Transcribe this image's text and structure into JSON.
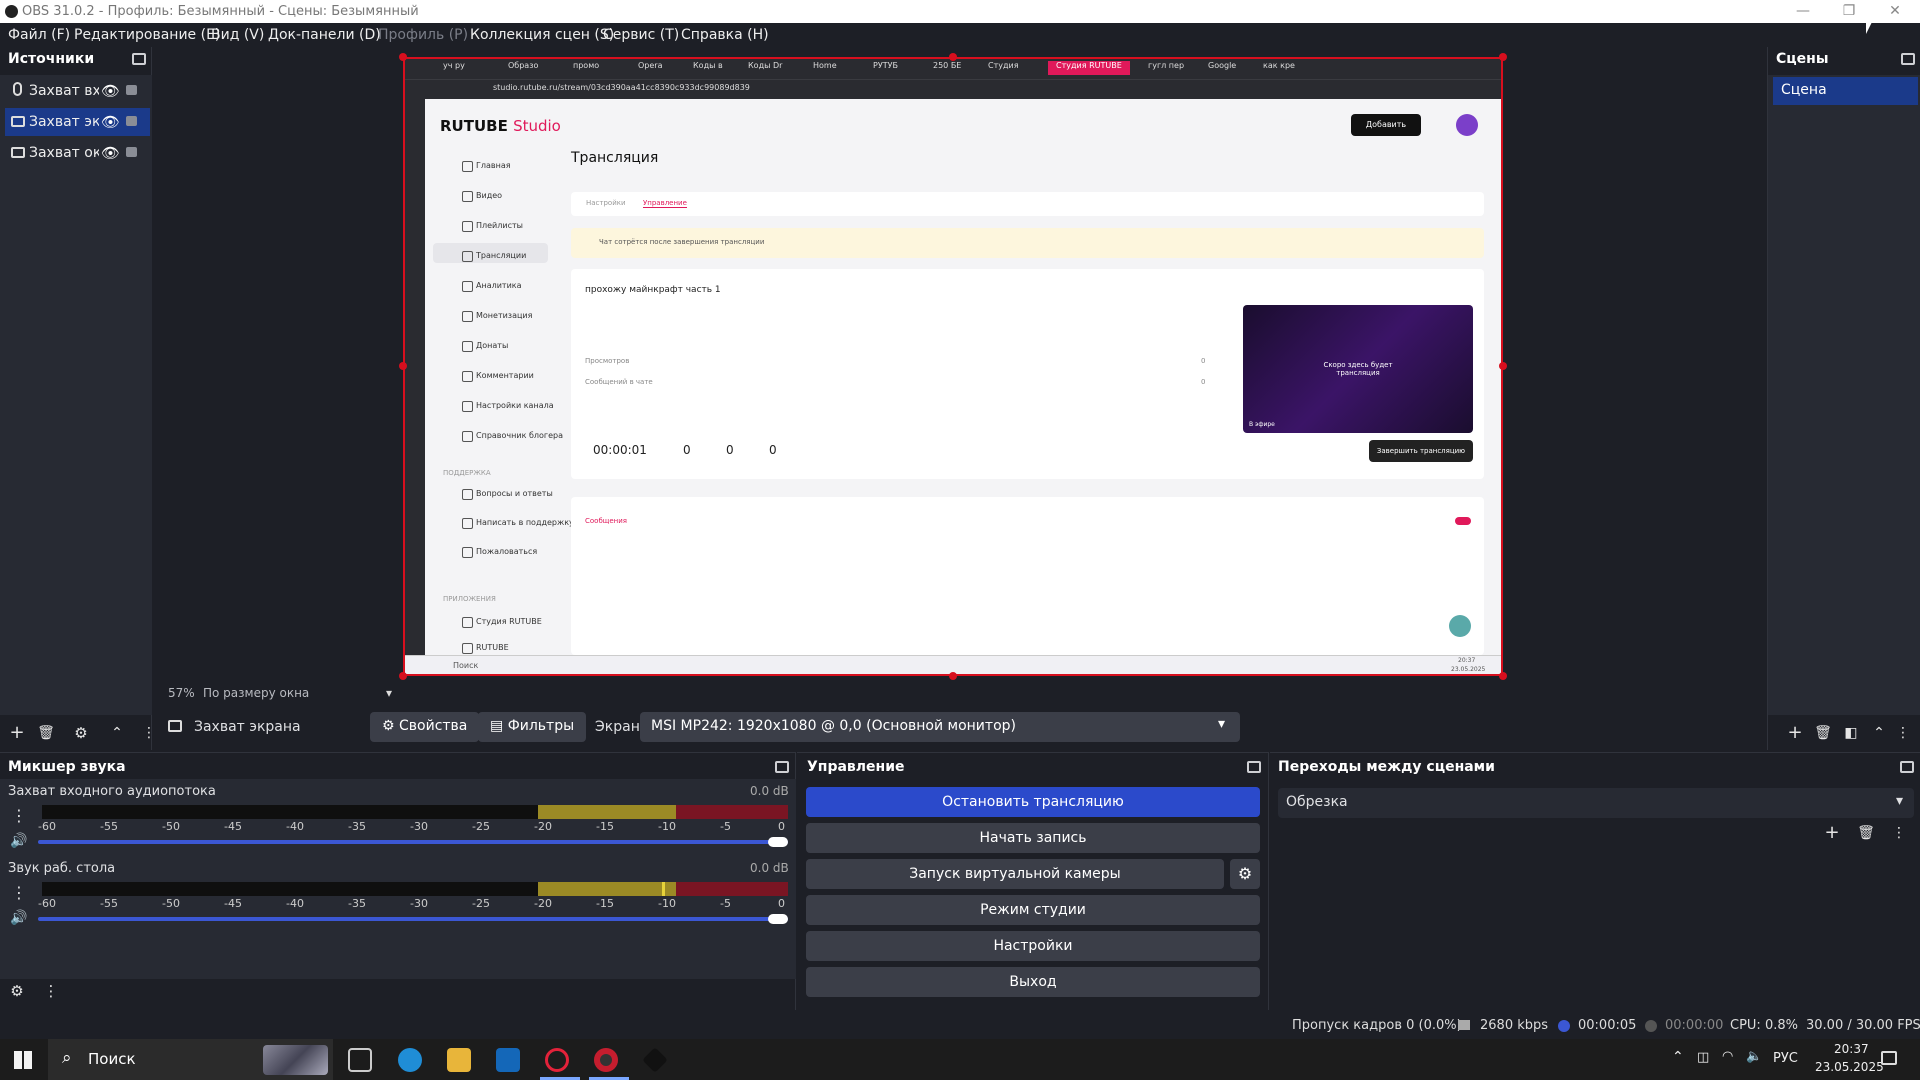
{
  "window": {
    "title": "OBS 31.0.2 - Профиль: Безымянный - Сцены: Безымянный",
    "minimize": "—",
    "maximize": "❐",
    "close": "✕"
  },
  "menu": [
    "Файл (F)",
    "Редактирование (E)",
    "Вид (V)",
    "Док-панели (D)",
    "Профиль (P)",
    "Коллекция сцен (S)",
    "Сервис (T)",
    "Справка (H)"
  ],
  "sources": {
    "title": "Источники",
    "items": [
      {
        "label": "Захват вхо",
        "icon": "microphone-icon"
      },
      {
        "label": "Захват экр",
        "icon": "monitor-icon",
        "selected": true
      },
      {
        "label": "Захват окн",
        "icon": "window-icon"
      }
    ]
  },
  "scenes": {
    "title": "Сцены",
    "items": [
      {
        "label": "Сцена",
        "selected": true
      }
    ]
  },
  "preview": {
    "zoom": "57%",
    "fit": "По размеру окна",
    "browser": {
      "tabs": [
        "уч ру",
        "Образо",
        "промо",
        "Opera",
        "Коды в",
        "Коды Dr",
        "Home",
        "РУТУБ",
        "250 БЕ",
        "Студия",
        "Студия RUTUBE",
        "гугл пер",
        "Google",
        "как кре"
      ],
      "url": "studio.rutube.ru/stream/03cd390aa41cc8390c933dc99089d839"
    },
    "rutube": {
      "logo": "RUTUBE",
      "logo2": "Studio",
      "add_button": "Добавить",
      "page_title": "Трансляция",
      "tab_settings": "Настройки",
      "tab_manage": "Управление",
      "notice": "Чат сотрётся после завершения трансляции",
      "nav": [
        "Главная",
        "Видео",
        "Плейлисты",
        "Трансляции",
        "Аналитика",
        "Монетизация",
        "Донаты",
        "Комментарии",
        "Настройки канала",
        "Справочник блогера"
      ],
      "support_title": "ПОДДЕРЖКА",
      "support": [
        "Вопросы и ответы",
        "Написать в поддержку",
        "Пожаловаться"
      ],
      "apps_title": "ПРИЛОЖЕНИЯ",
      "apps": [
        "Студия RUTUBE",
        "RUTUBE"
      ],
      "stream_title": "прохожу майнкрафт часть 1",
      "views_label": "Просмотров",
      "views_value": "0",
      "messages_label": "Сообщений в чате",
      "messages_value": "0",
      "timer": "00:00:01",
      "stat1": "0",
      "stat2": "0",
      "stat3": "0",
      "preview_text": "Скоро здесь будет трансляция",
      "live_label": "В эфире",
      "end_button": "Завершить трансляцию",
      "chat_tab": "Сообщения",
      "search": "Поиск",
      "clock": "20:37",
      "date": "23.05.2025"
    }
  },
  "props": {
    "source_name": "Захват экрана",
    "properties": "Свойства",
    "filters": "Фильтры",
    "screen_label": "Экран",
    "screen_value": "MSI MP242: 1920x1080 @ 0,0 (Основной монитор)"
  },
  "mixer": {
    "title": "Микшер звука",
    "ticks": [
      "-60",
      "-55",
      "-50",
      "-45",
      "-40",
      "-35",
      "-30",
      "-25",
      "-20",
      "-15",
      "-10",
      "-5",
      "0"
    ],
    "channels": [
      {
        "name": "Захват входного аудиопотока",
        "db": "0.0 dB",
        "volume": 1.0
      },
      {
        "name": "Звук раб. стола",
        "db": "0.0 dB",
        "volume": 1.0
      }
    ]
  },
  "controls": {
    "title": "Управление",
    "buttons": [
      "Остановить трансляцию",
      "Начать запись",
      "Запуск виртуальной камеры",
      "Режим студии",
      "Настройки",
      "Выход"
    ]
  },
  "transitions": {
    "title": "Переходы между сценами",
    "value": "Обрезка"
  },
  "status": {
    "dropped": "Пропуск кадров 0 (0.0%)",
    "bitrate": "2680 kbps",
    "stream_time": "00:00:05",
    "rec_time": "00:00:00",
    "cpu": "CPU: 0.8%",
    "fps": "30.00 / 30.00 FPS"
  },
  "taskbar": {
    "search": "Поиск",
    "lang": "РУС",
    "time": "20:37",
    "date": "23.05.2025"
  },
  "colors": {
    "accent": "#2b4acb",
    "selection": "#1b3a8a",
    "bg": "#1d1f26",
    "redbox": "#d70f1e",
    "rutube_pink": "#e0195a"
  }
}
